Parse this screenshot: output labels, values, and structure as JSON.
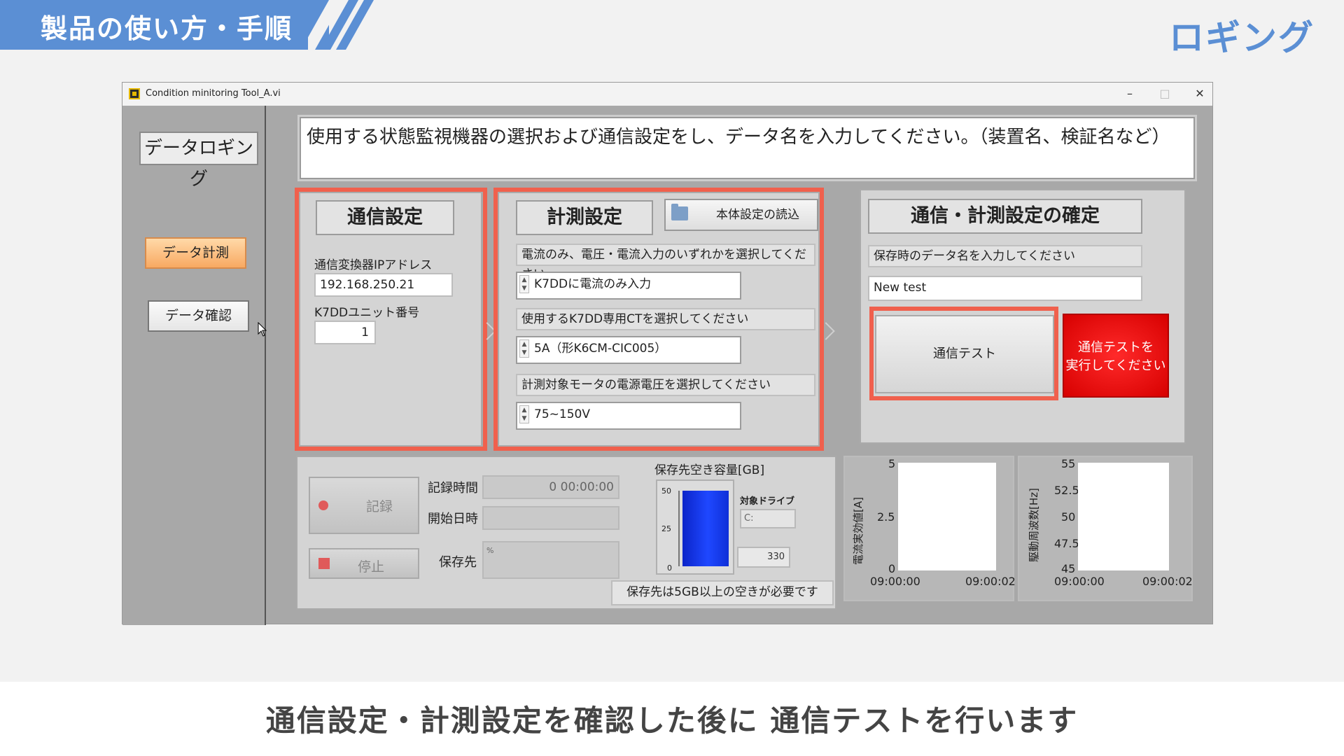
{
  "slide": {
    "title": "製品の使い方・手順",
    "corner_label": "ロギング",
    "caption": "通信設定・計測設定を確認した後に 通信テストを行います",
    "accent_color": "#5b8fd4"
  },
  "window": {
    "title": "Condition minitoring Tool_A.vi",
    "icon": "labview-vi-icon",
    "controls": {
      "minimize": "–",
      "maximize": "□",
      "close": "✕"
    }
  },
  "sidebar": {
    "title": "データロギング",
    "items": [
      {
        "label": "データ計測",
        "active": true
      },
      {
        "label": "データ確認",
        "active": false
      }
    ]
  },
  "message": "使用する状態監視機器の選択および通信設定をし、データ名を入力してください。（装置名、検証名など）",
  "comm_settings": {
    "header": "通信設定",
    "ip_label": "通信変換器IPアドレス",
    "ip_value": "192.168.250.21",
    "unit_label": "K7DDユニット番号",
    "unit_value": "1"
  },
  "meas_settings": {
    "header": "計測設定",
    "load_button": "本体設定の読込",
    "prompt_input": "電流のみ、電圧・電流入力のいずれかを選択してください",
    "input_mode": "K7DDに電流のみ入力",
    "prompt_ct": "使用するK7DD専用CTを選択してください",
    "ct_value": "5A（形K6CM-CIC005）",
    "prompt_voltage": "計測対象モータの電源電圧を選択してください",
    "voltage_value": "75~150V"
  },
  "confirm": {
    "header": "通信・計測設定の確定",
    "prompt_name": "保存時のデータ名を入力してください",
    "data_name": "New test",
    "test_button": "通信テスト",
    "indicator_line1": "通信テストを",
    "indicator_line2": "実行してください",
    "indicator_color": "#e60000"
  },
  "recording": {
    "record_button": "記録",
    "stop_button": "停止",
    "rec_time_label": "記録時間",
    "rec_time_value": "0  00:00:00",
    "start_label": "開始日時",
    "start_value": "",
    "dest_label": "保存先",
    "dest_value": "%",
    "free_space_label": "保存先空き容量[GB]",
    "gauge_ticks": [
      "50",
      "25",
      "0"
    ],
    "gauge_level_fraction": 1.0,
    "drive_label": "対象ドライブ",
    "drive_value": "C:",
    "free_space_value": "330",
    "note": "保存先は5GB以上の空きが必要です"
  },
  "chart_data": [
    {
      "type": "line",
      "ylabel": "電流実効値[A]",
      "ylim": [
        0,
        5
      ],
      "y_ticks": [
        "5",
        "2.5",
        "0"
      ],
      "x_ticks": [
        "09:00:00",
        "09:00:02"
      ],
      "series": []
    },
    {
      "type": "line",
      "ylabel": "駆動周波数[Hz]",
      "ylim": [
        45,
        55
      ],
      "y_ticks": [
        "55",
        "52.5",
        "50",
        "47.5",
        "45"
      ],
      "x_ticks": [
        "09:00:00",
        "09:00:02"
      ],
      "series": []
    }
  ]
}
